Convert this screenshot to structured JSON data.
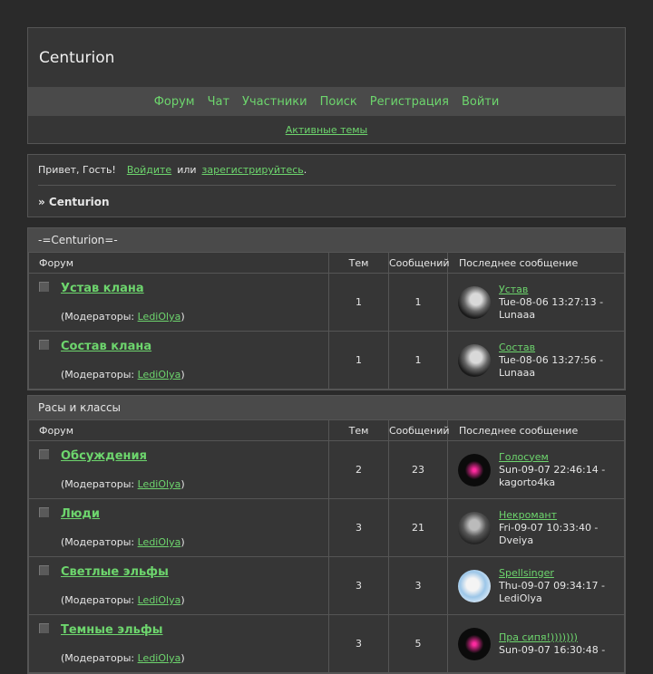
{
  "site": {
    "title": "Centurion"
  },
  "nav": [
    "Форум",
    "Чат",
    "Участники",
    "Поиск",
    "Регистрация",
    "Войти"
  ],
  "subnav": {
    "active_topics": "Активные темы"
  },
  "welcome": {
    "greeting": "Привет, Гость!",
    "login": "Войдите",
    "or": "или",
    "register": "зарегистрируйтесь",
    "period": "."
  },
  "breadcrumb": "» Centurion",
  "table_headers": {
    "forum": "Форум",
    "topics": "Тем",
    "posts": "Сообщений",
    "last": "Последнее сообщение"
  },
  "mods_prefix": "(Модераторы: ",
  "mods_suffix": ")",
  "categories": [
    {
      "title": "-=Centurion=-",
      "forums": [
        {
          "name": "Устав клана",
          "moderator": "LediOlya",
          "topics": "1",
          "posts": "1",
          "last_topic": "Устав",
          "last_time": "Tue-08-06 13:27:13 -",
          "last_user": "Lunaaa",
          "avatar": "av-a"
        },
        {
          "name": "Состав клана",
          "moderator": "LediOlya",
          "topics": "1",
          "posts": "1",
          "last_topic": "Состав",
          "last_time": "Tue-08-06 13:27:56 -",
          "last_user": "Lunaaa",
          "avatar": "av-a"
        }
      ]
    },
    {
      "title": "Расы и классы",
      "forums": [
        {
          "name": "Обсуждения",
          "moderator": "LediOlya",
          "topics": "2",
          "posts": "23",
          "last_topic": "Голосуем",
          "last_time": "Sun-09-07 22:46:14 -",
          "last_user": "kagorto4ka",
          "avatar": "av-b"
        },
        {
          "name": "Люди",
          "moderator": "LediOlya",
          "topics": "3",
          "posts": "21",
          "last_topic": "Некромант",
          "last_time": "Fri-09-07 10:33:40 -",
          "last_user": "Dveiya",
          "avatar": "av-c"
        },
        {
          "name": "Светлые эльфы",
          "moderator": "LediOlya",
          "topics": "3",
          "posts": "3",
          "last_topic": "Spellsinger",
          "last_time": "Thu-09-07 09:34:17 -",
          "last_user": "LediOlya",
          "avatar": "av-d"
        },
        {
          "name": "Темные эльфы",
          "moderator": "LediOlya",
          "topics": "3",
          "posts": "5",
          "last_topic": "Пра сипя!)))))))",
          "last_time": "Sun-09-07 16:30:48 -",
          "last_user": "",
          "avatar": "av-b"
        }
      ]
    }
  ]
}
